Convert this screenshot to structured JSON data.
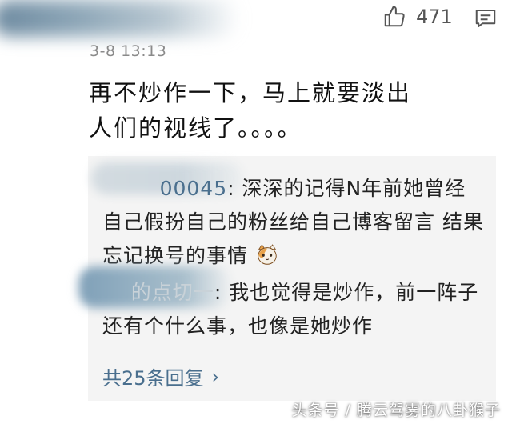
{
  "comment": {
    "timestamp": "3-8 13:13",
    "like_count": "471",
    "text": "再不炒作一下，马上就要淡出人们的视线了。。。。",
    "icons": {
      "like": "thumbs-up-icon",
      "reply": "comment-icon"
    }
  },
  "replies": [
    {
      "author_suffix": "00045",
      "text": "深深的记得N年前她曾经自己假扮自己的粉丝给自己博客留言 结果忘记换号的事情",
      "emoji": "cat-face-emoji"
    },
    {
      "author_suffix": "的点切一",
      "text": "我也觉得是炒作，前一阵子还有个什么事，也像是她炒作"
    }
  ],
  "view_all": {
    "label": "共25条回复",
    "chevron": "›"
  },
  "watermark": "头条号 / 腾云驾雾的八卦猴子",
  "colors": {
    "link": "#4a6f8e",
    "reply_background": "#f4f4f4",
    "timestamp": "#8a8a8a"
  }
}
